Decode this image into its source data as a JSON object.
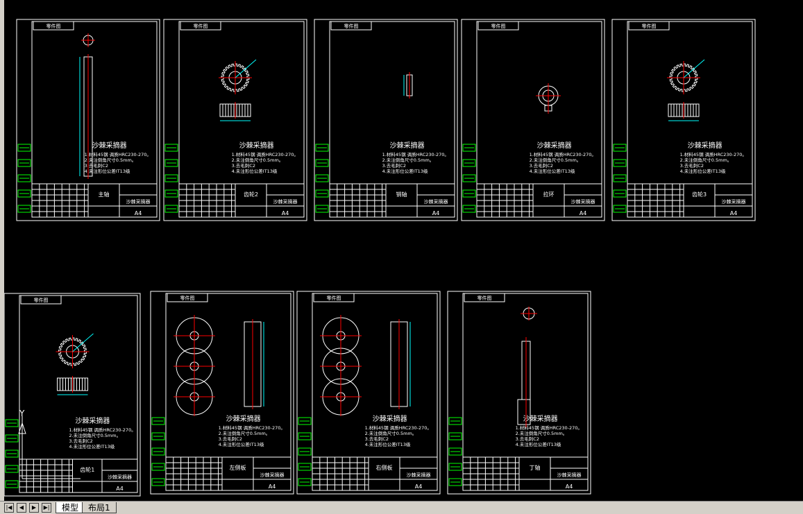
{
  "sheets": [
    {
      "name": "main-shaft",
      "header": "零件图",
      "title": "沙棘采摘器",
      "part": "主轴",
      "project": "沙棘采摘器",
      "size": "A4",
      "icon": "shaft",
      "notes": [
        "1.材料45钢 调质HRC230-270。",
        "2.未注倒角尺寸0.5mm。",
        "3.去毛刺C2",
        "4.未注形位公差IT13级"
      ]
    },
    {
      "name": "gear-2",
      "header": "零件图",
      "title": "沙棘采摘器",
      "part": "齿轮2",
      "project": "沙棘采摘器",
      "size": "A4",
      "icon": "gear",
      "notes": [
        "1.材料45钢 调质HRC230-270。",
        "2.未注倒角尺寸0.5mm。",
        "3.去毛刺C2",
        "4.未注形位公差IT13级"
      ]
    },
    {
      "name": "pin",
      "header": "零件图",
      "title": "沙棘采摘器",
      "part": "销轴",
      "project": "沙棘采摘器",
      "size": "A4",
      "icon": "pin",
      "notes": [
        "1.材料45钢 调质HRC230-270。",
        "2.未注倒角尺寸0.5mm。",
        "3.去毛刺C2",
        "4.未注形位公差IT13级"
      ]
    },
    {
      "name": "eyebolt",
      "header": "零件图",
      "title": "沙棘采摘器",
      "part": "拉环",
      "project": "沙棘采摘器",
      "size": "A4",
      "icon": "eyebolt",
      "notes": [
        "1.材料45钢 调质HRC230-270。",
        "2.未注倒角尺寸0.5mm。",
        "3.去毛刺C2",
        "4.未注形位公差IT13级"
      ]
    },
    {
      "name": "gear-3",
      "header": "零件图",
      "title": "沙棘采摘器",
      "part": "齿轮3",
      "project": "沙棘采摘器",
      "size": "A4",
      "icon": "gear",
      "notes": [
        "1.材料45钢 调质HRC230-270。",
        "2.未注倒角尺寸0.5mm。",
        "3.去毛刺C2",
        "4.未注形位公差IT13级"
      ]
    },
    {
      "name": "gear-1",
      "header": "零件图",
      "title": "沙棘采摘器",
      "part": "齿轮1",
      "project": "沙棘采摘器",
      "size": "A4",
      "icon": "gear",
      "notes": [
        "1.材料45钢 调质HRC230-270。",
        "2.未注倒角尺寸0.5mm。",
        "3.去毛刺C2",
        "4.未注形位公差IT13级"
      ]
    },
    {
      "name": "left-plate",
      "header": "零件图",
      "title": "沙棘采摘器",
      "part": "左侧板",
      "project": "沙棘采摘器",
      "size": "A4",
      "icon": "plate",
      "notes": [
        "1.材料45钢 调质HRC230-270。",
        "2.未注倒角尺寸0.5mm。",
        "3.去毛刺C2",
        "4.未注形位公差IT13级"
      ]
    },
    {
      "name": "right-plate",
      "header": "零件图",
      "title": "沙棘采摘器",
      "part": "右侧板",
      "project": "沙棘采摘器",
      "size": "A4",
      "icon": "plate2",
      "notes": [
        "1.材料45钢 调质HRC230-270。",
        "2.未注倒角尺寸0.5mm。",
        "3.去毛刺C2",
        "4.未注形位公差IT13级"
      ]
    },
    {
      "name": "shaft-2",
      "header": "零件图",
      "title": "沙棘采摘器",
      "part": "丁轴",
      "project": "沙棘采摘器",
      "size": "A4",
      "icon": "shaft2",
      "notes": [
        "1.材料45钢 调质HRC230-270。",
        "2.未注倒角尺寸0.5mm。",
        "3.去毛刺C2",
        "4.未注形位公差IT13级"
      ]
    }
  ],
  "tabs": {
    "model": "模型",
    "layout1": "布局1"
  },
  "nav": {
    "first": "|◀",
    "prev": "◀",
    "next": "▶",
    "last": "▶|"
  },
  "ucs": {
    "y_label": "Y"
  },
  "colors": {
    "border": "#ffffff",
    "green": "#00ff00",
    "red": "#ff0000",
    "cyan": "#00ffff",
    "title": "#ffffff"
  }
}
